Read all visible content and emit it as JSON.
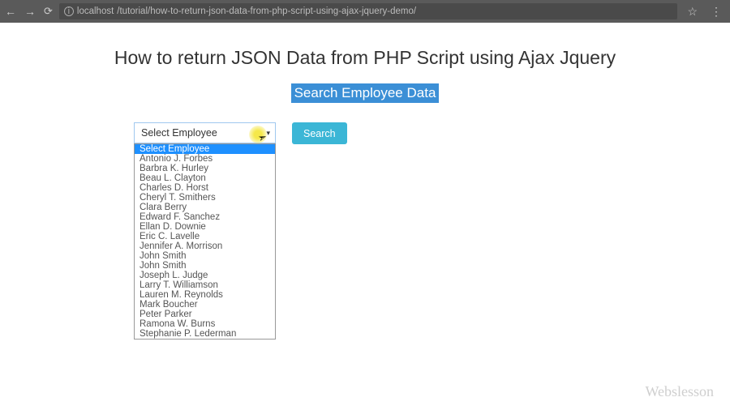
{
  "browser": {
    "url_host": "localhost",
    "url_path": "/tutorial/how-to-return-json-data-from-php-script-using-ajax-jquery-demo/"
  },
  "page": {
    "title": "How to return JSON Data from PHP Script using Ajax Jquery",
    "subtitle": "Search Employee Data"
  },
  "form": {
    "select_placeholder": "Select Employee",
    "search_button": "Search",
    "options": [
      "Select Employee",
      "Antonio J. Forbes",
      "Barbra K. Hurley",
      "Beau L. Clayton",
      "Charles D. Horst",
      "Cheryl T. Smithers",
      "Clara Berry",
      "Edward F. Sanchez",
      "Ellan D. Downie",
      "Eric C. Lavelle",
      "Jennifer A. Morrison",
      "John Smith",
      "John Smith",
      "Joseph L. Judge",
      "Larry T. Williamson",
      "Lauren M. Reynolds",
      "Mark Boucher",
      "Peter Parker",
      "Ramona W. Burns",
      "Stephanie P. Lederman"
    ]
  },
  "watermark": "Webslesson"
}
